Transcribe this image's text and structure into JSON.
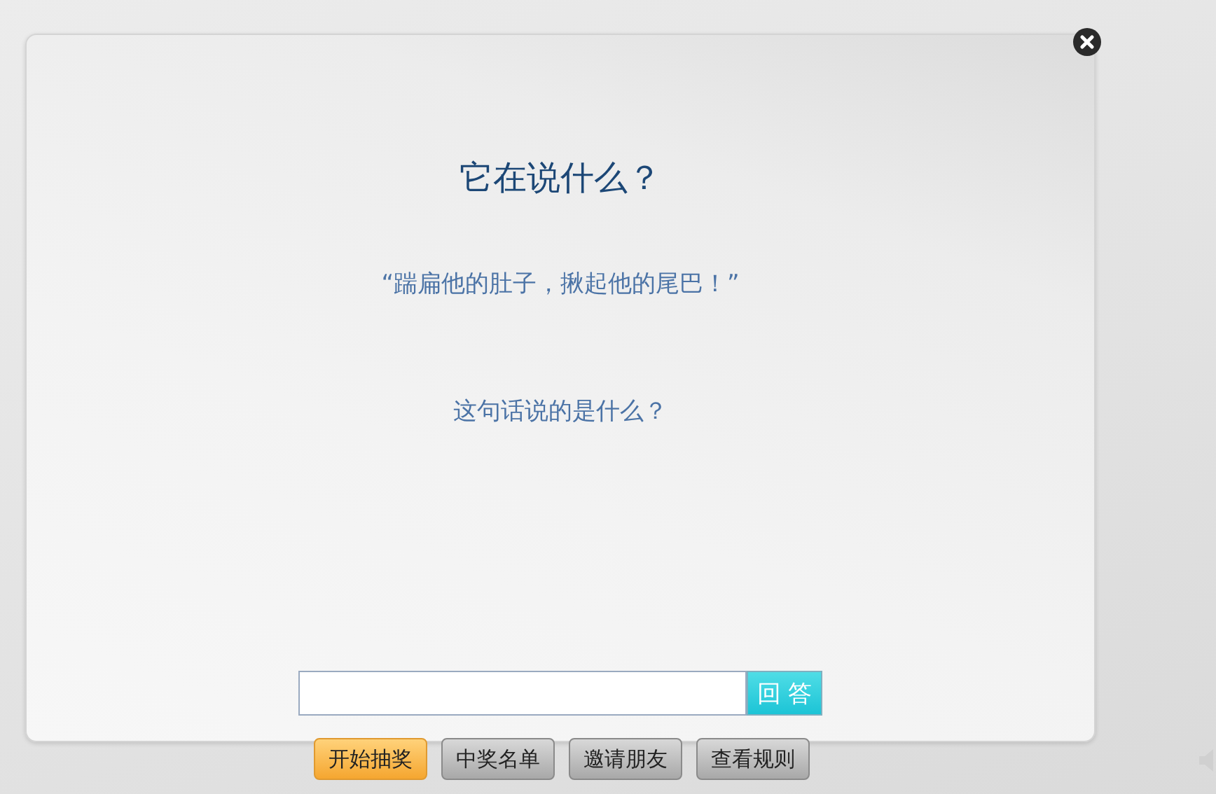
{
  "dialog": {
    "title": "它在说什么？",
    "quote": "“踹扁他的肚子，揪起他的尾巴！”",
    "question": "这句话说的是什么？",
    "answer": {
      "button": "回 答"
    }
  },
  "buttons": [
    {
      "label": "开始抽奖",
      "selected": true
    },
    {
      "label": "中奖名单",
      "selected": false
    },
    {
      "label": "邀请朋友",
      "selected": false
    },
    {
      "label": "查看规则",
      "selected": false
    }
  ]
}
